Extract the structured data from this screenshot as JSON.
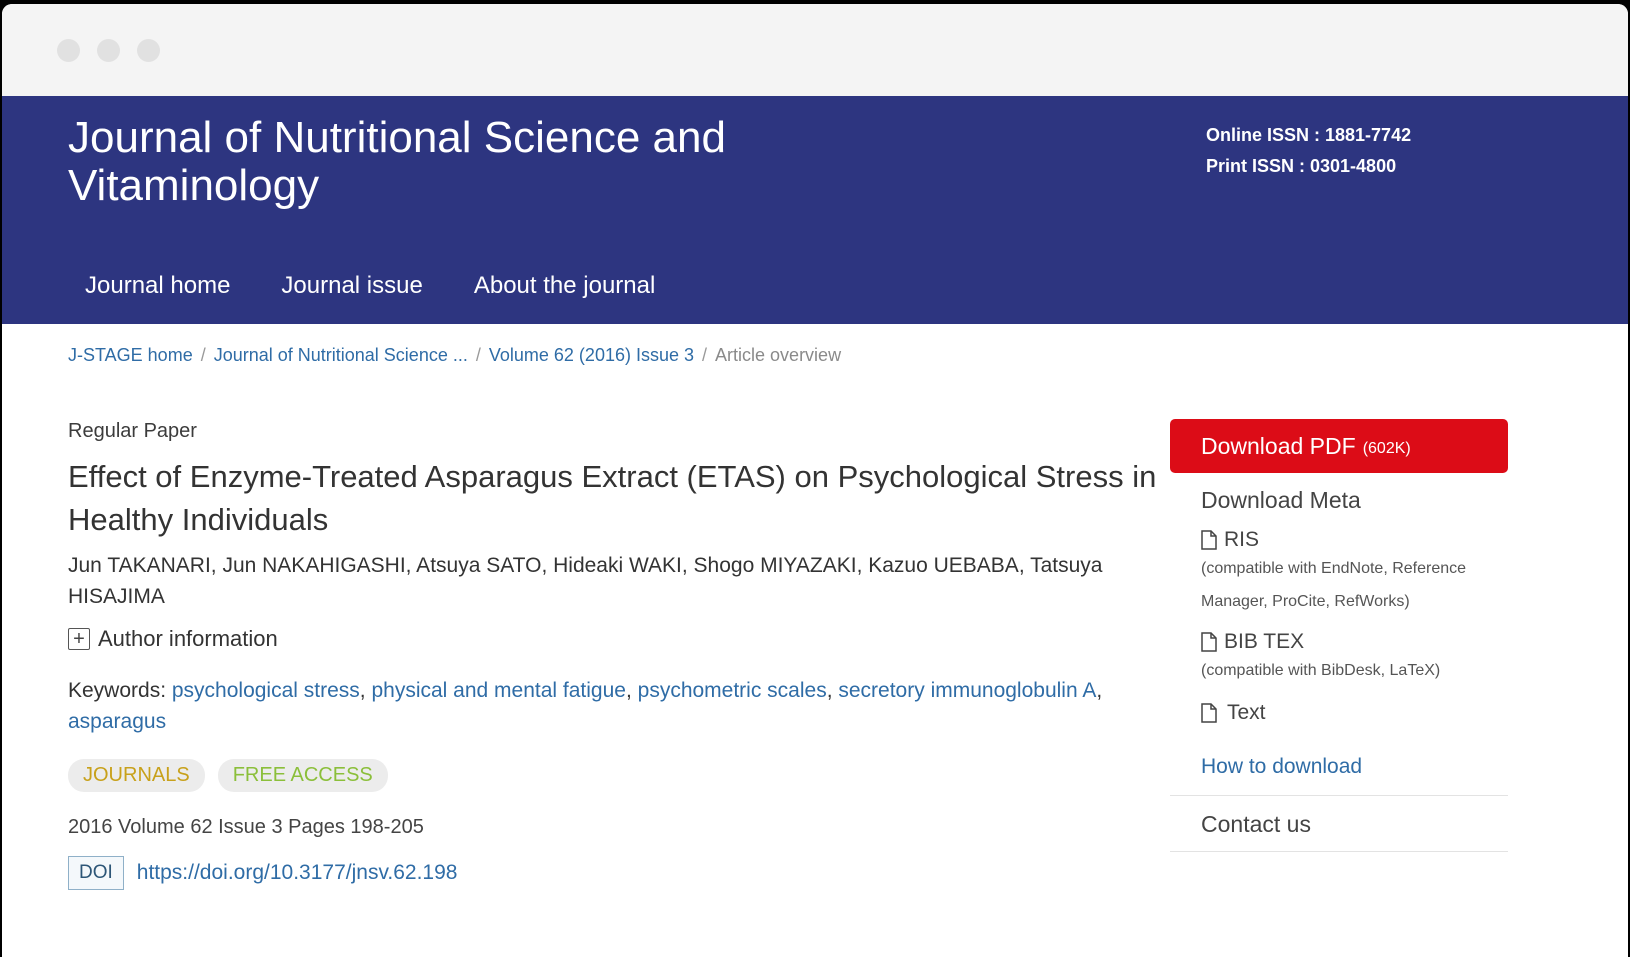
{
  "header": {
    "title": "Journal of Nutritional Science and Vitaminology",
    "online_issn": "Online ISSN : 1881-7742",
    "print_issn": "Print ISSN : 0301-4800",
    "nav": [
      "Journal home",
      "Journal issue",
      "About the journal"
    ]
  },
  "breadcrumb": {
    "items": [
      "J-STAGE home",
      "Journal of Nutritional Science ...",
      "Volume 62 (2016) Issue 3"
    ],
    "current": "Article overview",
    "separator": "/"
  },
  "article": {
    "type": "Regular Paper",
    "title": "Effect of Enzyme-Treated Asparagus Extract (ETAS) on Psychological Stress in Healthy Individuals",
    "authors": "Jun TAKANARI, Jun NAKAHIGASHI, Atsuya SATO, Hideaki WAKI, Shogo MIYAZAKI, Kazuo UEBABA, Tatsuya HISAJIMA",
    "author_info_label": "Author information",
    "keywords_label": "Keywords: ",
    "keywords": [
      "psychological stress",
      "physical and mental fatigue",
      "psychometric scales",
      "secretory immunoglobulin A",
      "asparagus"
    ],
    "badges": [
      "JOURNALS",
      "FREE ACCESS"
    ],
    "volume_info": "2016 Volume 62 Issue 3 Pages 198-205",
    "doi_label": "DOI",
    "doi_url": "https://doi.org/10.3177/jnsv.62.198"
  },
  "sidebar": {
    "download_pdf_label": "Download PDF",
    "pdf_size": "(602K)",
    "download_meta_title": "Download Meta",
    "ris_label": "RIS",
    "ris_note": "(compatible with EndNote, Reference Manager, ProCite, RefWorks)",
    "bibtex_label": "BIB TEX",
    "bibtex_note": "(compatible with BibDesk, LaTeX)",
    "text_label": "Text",
    "how_to_download": "How to download",
    "contact_us": "Contact us"
  },
  "icons": {
    "author_info": "plus-box-icon",
    "meta_file": "document-icon"
  },
  "colors": {
    "header_bg": "#2d3580",
    "pdf_button": "#dc0c17",
    "link": "#2f6ca6",
    "badge_journals": "#c8a11b",
    "badge_free_access": "#8bbf3a"
  }
}
